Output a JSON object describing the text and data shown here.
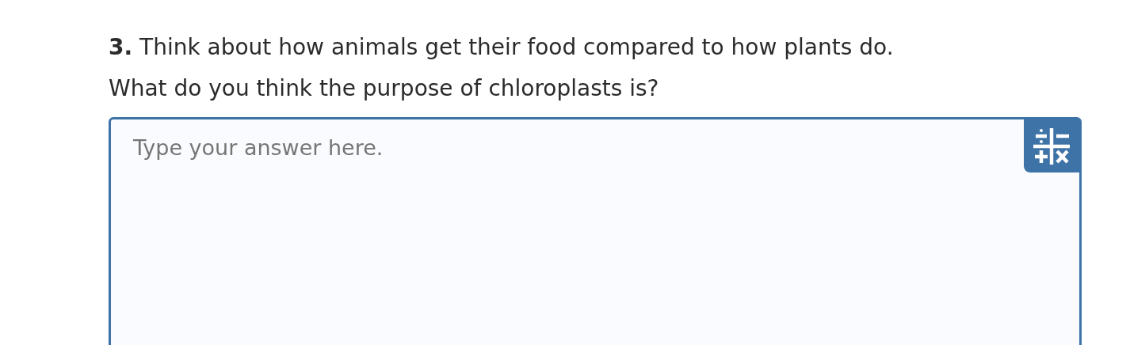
{
  "question": {
    "text": "**3.** Think about how animals get their food compared to how plants do. What do you think the purpose of chloroplasts is?"
  },
  "answer": {
    "placeholder": "Type your answer here."
  }
}
